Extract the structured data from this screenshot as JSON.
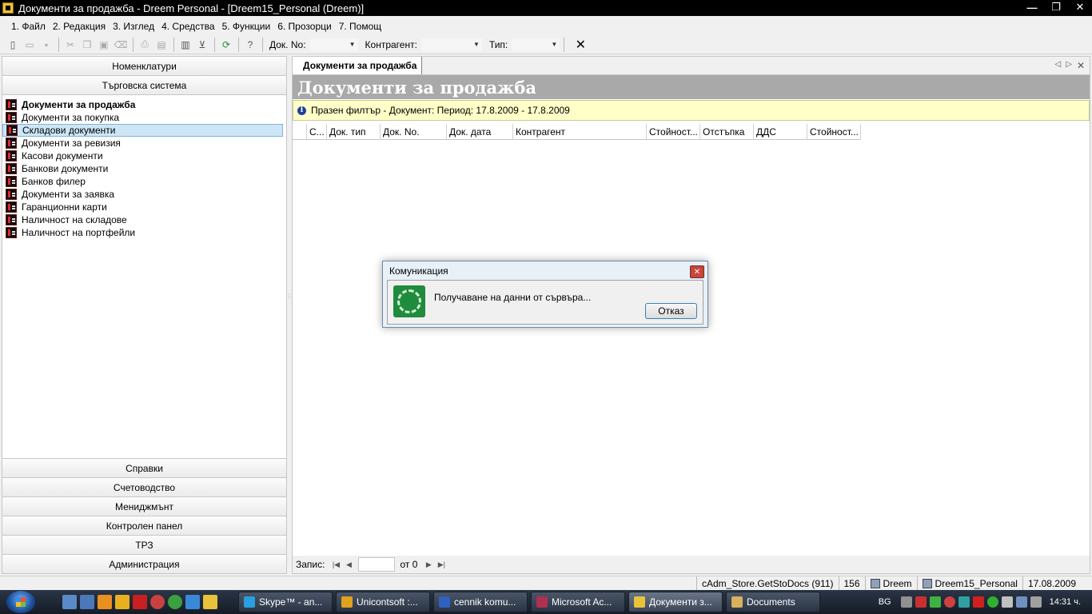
{
  "window": {
    "title": "Документи за продажба - Dreem Personal - [Dreem15_Personal (Dreem)]",
    "buttons": {
      "minimize": "—",
      "restore": "❐",
      "close": "✕"
    }
  },
  "menu": [
    {
      "label": "1. Файл"
    },
    {
      "label": "2. Редакция"
    },
    {
      "label": "3. Изглед"
    },
    {
      "label": "4. Средства"
    },
    {
      "label": "5. Функции"
    },
    {
      "label": "6. Прозорци"
    },
    {
      "label": "7. Помощ"
    }
  ],
  "toolbar": {
    "doc_no_label": "Док. No:",
    "doc_no_value": "",
    "contragent_label": "Контрагент:",
    "contragent_value": "",
    "type_label": "Тип:",
    "type_value": "",
    "close_glyph": "✕"
  },
  "sidebar": {
    "top_sections": [
      {
        "label": "Номенклатури"
      },
      {
        "label": "Търговска система"
      }
    ],
    "items": [
      {
        "label": "Документи за продажба",
        "state": "bold"
      },
      {
        "label": "Документи за покупка",
        "state": ""
      },
      {
        "label": "Складови документи",
        "state": "selected"
      },
      {
        "label": "Документи за ревизия",
        "state": ""
      },
      {
        "label": "Касови документи",
        "state": ""
      },
      {
        "label": "Банкови документи",
        "state": ""
      },
      {
        "label": "Банков филер",
        "state": ""
      },
      {
        "label": "Документи за заявка",
        "state": ""
      },
      {
        "label": "Гаранционни карти",
        "state": ""
      },
      {
        "label": "Наличност на складове",
        "state": ""
      },
      {
        "label": "Наличност на портфейли",
        "state": ""
      }
    ],
    "bottom_sections": [
      {
        "label": "Справки"
      },
      {
        "label": "Счетоводство"
      },
      {
        "label": "Мениджмънт"
      },
      {
        "label": "Контролен панел"
      },
      {
        "label": "ТРЗ"
      },
      {
        "label": "Администрация"
      }
    ]
  },
  "main": {
    "tab_label": "Документи за продажба",
    "banner_title": "Документи за продажба",
    "filter_text": "Празен филтър - Документ: Период: 17.8.2009 - 17.8.2009",
    "columns": [
      "С...",
      "Док. тип",
      "Док. No.",
      "Док. дата",
      "Контрагент",
      "Стойност...",
      "Отстъпка",
      "ДДС",
      "Стойност..."
    ],
    "pager": {
      "label": "Запис:",
      "current": "",
      "total": "от 0"
    }
  },
  "dialog": {
    "title": "Комуникация",
    "message": "Получаване на данни от сървъра...",
    "cancel_label": "Отказ"
  },
  "status": {
    "method": "cAdm_Store.GetStoDocs (911)",
    "count": "156",
    "user": "Dreem",
    "database": "Dreem15_Personal",
    "date": "17.08.2009"
  },
  "taskbar": {
    "tasks": [
      {
        "label": "Skype™ - an...",
        "color": "#2a9fe0"
      },
      {
        "label": "Unicontsoft :...",
        "color": "#e0a020"
      },
      {
        "label": "cennik komu...",
        "color": "#3060c0"
      },
      {
        "label": "Microsoft Ac...",
        "color": "#b03050"
      },
      {
        "label": "Документи з...",
        "color": "#e8c23a",
        "active": true
      },
      {
        "label": "Documents",
        "color": "#d8b060"
      }
    ],
    "language": "BG",
    "clock": "14:31 ч."
  },
  "colors": {
    "accent_selected": "#cde6f7",
    "banner_bg": "#a9a9a9",
    "filter_bg": "#ffffc8"
  }
}
